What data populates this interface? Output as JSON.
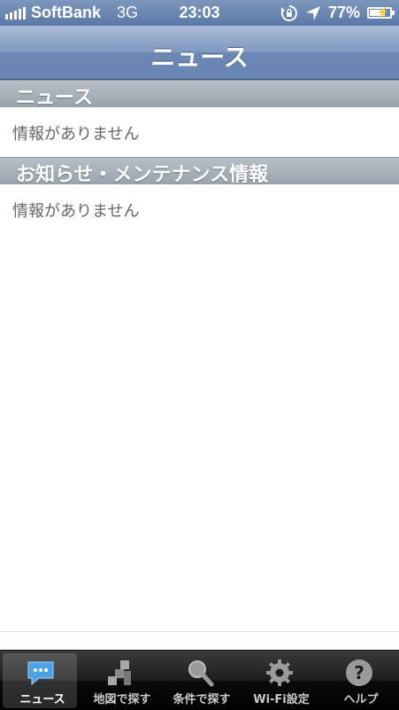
{
  "status_bar": {
    "carrier": "SoftBank",
    "network": "3G",
    "time": "23:03",
    "battery_percent": "77%",
    "battery_level": 0.77
  },
  "navbar": {
    "title": "ニュース"
  },
  "sections": [
    {
      "header": "ニュース",
      "empty_text": "情報がありません"
    },
    {
      "header": "お知らせ・メンテナンス情報",
      "empty_text": "情報がありません"
    }
  ],
  "tabbar": {
    "tabs": [
      {
        "label": "ニュース",
        "icon": "speech-bubble-icon",
        "selected": true
      },
      {
        "label": "地図で探す",
        "icon": "map-icon",
        "selected": false
      },
      {
        "label": "条件で探す",
        "icon": "magnifier-icon",
        "selected": false
      },
      {
        "label": "Wi-Fi設定",
        "icon": "gear-icon",
        "selected": false
      },
      {
        "label": "ヘルプ",
        "icon": "help-icon",
        "selected": false
      }
    ]
  },
  "colors": {
    "navbar": "#6c87b4",
    "section_header": "#9aa3ad",
    "accent_selected_icon": "#4aa3e6"
  }
}
